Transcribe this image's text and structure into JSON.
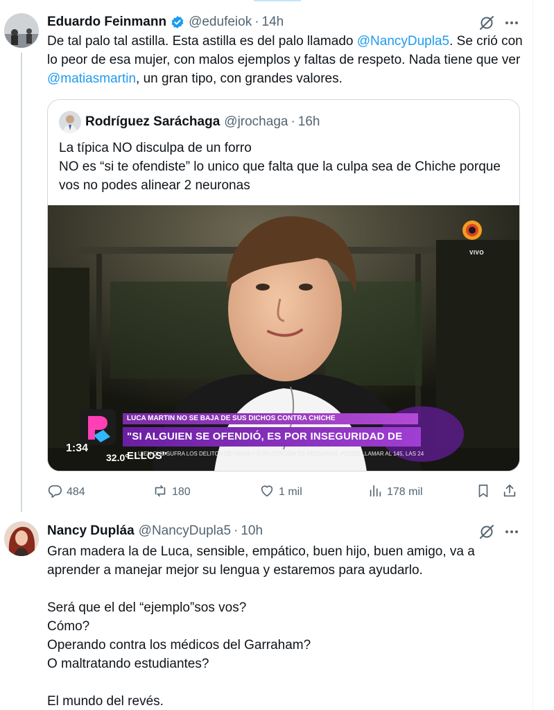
{
  "tweet1": {
    "name": "Eduardo Feinmann",
    "handle": "@edufeiok",
    "separator": "·",
    "time": "14h",
    "text_1": "De tal palo tal astilla. Esta astilla  es del palo llamado ",
    "mention_1": "@NancyDupla5",
    "text_2": ".  Se crió con lo peor de esa mujer, con malos ejemplos y faltas de respeto. Nada tiene que ver ",
    "mention_2": "@matiasmartin",
    "text_3": ", un gran tipo, con grandes valores.",
    "quote": {
      "name": "Rodríguez Saráchaga",
      "handle": "@jrochaga",
      "separator": "·",
      "time": "16h",
      "line_1": "La típica NO disculpa de un forro",
      "line_2": "NO es “si te ofendiste” lo unico que falta que la culpa sea de Chiche porque vos no podes alinear 2 neuronas"
    },
    "video": {
      "channel_badge": "VIVO",
      "banner_top": "LUCA MARTIN NO SE BAJA DE SUS DICHOS CONTRA CHICHE",
      "banner_main": "\"SI ALGUIEN SE OFENDIÓ, ES POR INSEGURIDAD DE ELLOS\"",
      "ticker": "UIEN QUE SUFRA LOS DELITOS DE TRATA Y EXPLOTACIÓN DE PERSONAS, PODÉS LLAMAR AL 145, LAS 24",
      "clock": "32.0°",
      "duration": "1:34"
    },
    "actions": {
      "replies": "484",
      "reposts": "180",
      "likes": "1 mil",
      "views": "178 mil"
    }
  },
  "tweet2": {
    "name": "Nancy Dupláa",
    "handle": "@NancyDupla5",
    "separator": "·",
    "time": "10h",
    "para_1": "Gran madera la de Luca, sensible, empático, buen hijo, buen amigo, va a aprender a manejar mejor su lengua y estaremos para ayudarlo.",
    "line_1": "Será que el del “ejemplo”sos vos?",
    "line_2": "Cómo?",
    "line_3": "Operando contra los médicos del Garraham?",
    "line_4": "O maltratando estudiantes?",
    "line_5": "El mundo del revés."
  },
  "icons": {
    "verified": "verified-badge-icon",
    "grok": "grok-icon",
    "more": "more-icon",
    "reply": "reply-icon",
    "repost": "repost-icon",
    "like": "like-icon",
    "views": "views-icon",
    "bookmark": "bookmark-icon",
    "share": "share-icon"
  },
  "colors": {
    "accent": "#1d9bf0",
    "text": "#0f1419",
    "secondary": "#536471",
    "border": "#cfd9de",
    "banner": "#8a2fc0"
  }
}
